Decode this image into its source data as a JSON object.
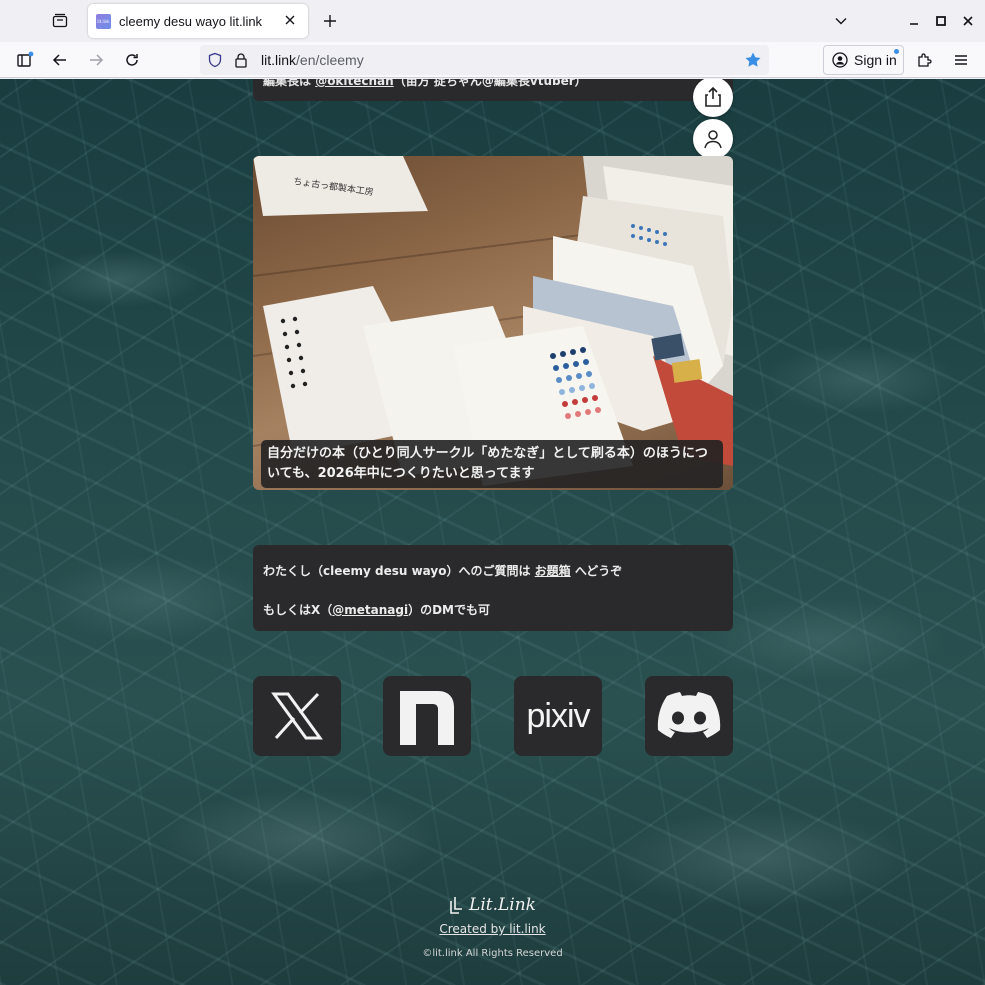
{
  "browser": {
    "tab_title": "cleemy desu wayo lit.link",
    "favicon_text": "lit.link",
    "url_host": "lit.link",
    "url_path": "/en/cleemy",
    "signin_label": "Sign in"
  },
  "page": {
    "top_card": {
      "text_prefix": "編集長は ",
      "link": "@okitechan",
      "text_suffix": "（亩方 捉ちゃん@編集長vtuber）"
    },
    "photo_caption": "自分だけの本（ひとり同人サークル「めたなぎ」として刷る本）のほうについても、2026年中につくりたいと思ってます",
    "photo_label": "ちょ古っ都製本工房",
    "info": {
      "line1_prefix": "わたくし（cleemy desu wayo）へのご質問は ",
      "line1_link": "お題箱",
      "line1_suffix": " へどうぞ",
      "line2_prefix": "もしくはX（",
      "line2_link": "@metanagi",
      "line2_suffix": "）のDMでも可"
    },
    "sns": {
      "pixiv_label": "pixiv"
    },
    "footer": {
      "logo_text": "Lit.Link",
      "created_by": "Created by lit.link",
      "copyright": "©lit.link All Rights Reserved"
    }
  },
  "colors": {
    "card_bg": "#2a2a2c",
    "bookmark_star": "#3a8ee6",
    "water_base": "#244a4b"
  }
}
